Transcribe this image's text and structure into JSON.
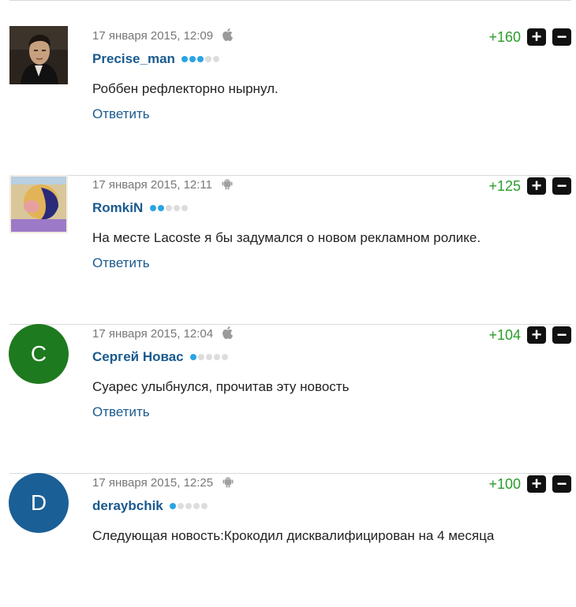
{
  "comments": [
    {
      "date": "17 января 2015, 12:09",
      "device": "apple-icon",
      "username": "Precise_man",
      "rating_dots": 3,
      "text": "Роббен рефлекторно нырнул.",
      "reply": "Ответить",
      "score": "+160",
      "avatar_type": "photo-man"
    },
    {
      "date": "17 января 2015, 12:11",
      "device": "android-icon",
      "username": "RomkiN",
      "rating_dots": 2,
      "text": "На месте Lacoste я бы задумался о новом рекламном ролике.",
      "reply": "Ответить",
      "score": "+125",
      "avatar_type": "image"
    },
    {
      "date": "17 января 2015, 12:04",
      "device": "apple-icon",
      "username": "Сергей Новас",
      "rating_dots": 1,
      "text": "Суарес улыбнулся, прочитав эту новость",
      "reply": "Ответить",
      "score": "+104",
      "avatar_letter": "C",
      "avatar_color": "#1e7a1e"
    },
    {
      "date": "17 января 2015, 12:25",
      "device": "android-icon",
      "username": "deraybchik",
      "rating_dots": 1,
      "text": "Следующая новость:Крокодил дисквалифицирован на 4 месяца",
      "score": "+100",
      "avatar_letter": "D",
      "avatar_color": "#1a5f96"
    }
  ],
  "vote_plus": "+",
  "vote_minus": "−"
}
